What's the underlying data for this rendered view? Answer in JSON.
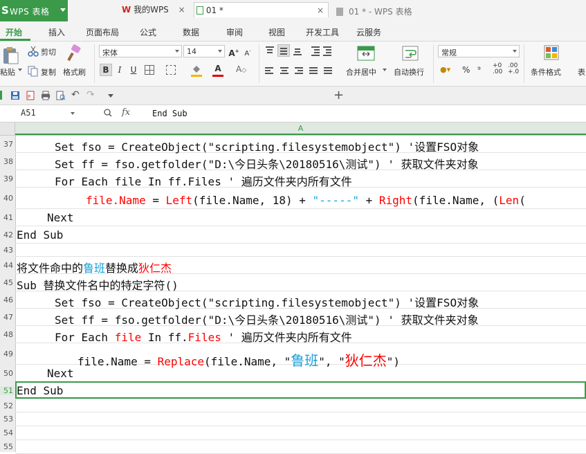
{
  "app": {
    "logo": "S",
    "name": "WPS 表格",
    "title": "01 * - WPS 表格"
  },
  "menu": {
    "tabs": [
      "开始",
      "插入",
      "页面布局",
      "公式",
      "数据",
      "审阅",
      "视图",
      "开发工具",
      "云服务"
    ]
  },
  "ribbon": {
    "cut": "剪切",
    "paste": "粘贴",
    "copy": "复制",
    "format_painter": "格式刷",
    "font_name": "宋体",
    "font_size": "14",
    "merge_center": "合并居中",
    "wrap_text": "自动换行",
    "number_format": "常规",
    "conditional_format": "条件格式",
    "table_style": "表"
  },
  "doc_tabs": {
    "mywps": "我的WPS",
    "current": "01 *"
  },
  "formula_bar": {
    "cell_ref": "A51",
    "fx": "fx",
    "content": "End Sub"
  },
  "grid": {
    "column": "A",
    "row_numbers": [
      "37",
      "38",
      "39",
      "40",
      "41",
      "42",
      "43",
      "44",
      "45",
      "46",
      "47",
      "48",
      "49",
      "50",
      "51",
      "52",
      "53",
      "54",
      "55"
    ],
    "rows": [
      {
        "row": "37",
        "indent": 55,
        "segments": [
          {
            "text": "Set fso = CreateObject(\"scripting.filesystemobject\") '设置FSO对象"
          }
        ]
      },
      {
        "row": "38",
        "indent": 55,
        "segments": [
          {
            "text": "Set ff = fso.getfolder(\"D:\\今日头条\\20180516\\测试\") ' 获取文件夹对象"
          }
        ]
      },
      {
        "row": "39",
        "indent": 55,
        "segments": [
          {
            "text": "For Each file In ff.Files  ' 遍历文件夹内所有文件"
          }
        ]
      },
      {
        "row": "40",
        "indent": 100,
        "segments": [
          {
            "text": "file.Name",
            "color": "red"
          },
          {
            "text": " = "
          },
          {
            "text": "Left",
            "color": "red"
          },
          {
            "text": "(file.Name, 18) + "
          },
          {
            "text": "\"-----\"",
            "color": "blue"
          },
          {
            "text": " + "
          },
          {
            "text": "Right",
            "color": "red"
          },
          {
            "text": "(file.Name, ("
          },
          {
            "text": "Len",
            "color": "red"
          },
          {
            "text": "("
          }
        ]
      },
      {
        "row": "41",
        "indent": 44,
        "segments": [
          {
            "text": "Next"
          }
        ]
      },
      {
        "row": "42",
        "indent": 0,
        "segments": [
          {
            "text": "End Sub"
          }
        ]
      },
      {
        "row": "43",
        "indent": 0,
        "segments": []
      },
      {
        "row": "44",
        "indent": 0,
        "segments": [
          {
            "text": "将文件命中的"
          },
          {
            "text": "鲁班",
            "color": "blue"
          },
          {
            "text": "替换成"
          },
          {
            "text": "狄仁杰",
            "color": "red"
          }
        ]
      },
      {
        "row": "45",
        "indent": 0,
        "segments": [
          {
            "text": "Sub 替换文件名中的特定字符()"
          }
        ]
      },
      {
        "row": "46",
        "indent": 55,
        "segments": [
          {
            "text": "Set fso = CreateObject(\"scripting.filesystemobject\") '设置FSO对象"
          }
        ]
      },
      {
        "row": "47",
        "indent": 55,
        "segments": [
          {
            "text": "Set ff = fso.getfolder(\"D:\\今日头条\\20180516\\测试\") ' 获取文件夹对象"
          }
        ]
      },
      {
        "row": "48",
        "indent": 55,
        "segments": [
          {
            "text": "For Each "
          },
          {
            "text": "file",
            "color": "red"
          },
          {
            "text": " In ff."
          },
          {
            "text": "Files",
            "color": "red"
          },
          {
            "text": "  ' 遍历文件夹内所有文件"
          }
        ]
      },
      {
        "row": "49",
        "indent": 88,
        "segments": [
          {
            "text": "file.Name = "
          },
          {
            "text": "Replace",
            "color": "red"
          },
          {
            "text": "(file.Name, \""
          },
          {
            "text": "鲁班",
            "color": "blue",
            "size": 20
          },
          {
            "text": "\", \""
          },
          {
            "text": "狄仁杰",
            "color": "red",
            "size": 20
          },
          {
            "text": "\")"
          }
        ]
      },
      {
        "row": "50",
        "indent": 44,
        "segments": [
          {
            "text": "Next"
          }
        ]
      },
      {
        "row": "51",
        "indent": 0,
        "segments": [
          {
            "text": "End Sub"
          }
        ]
      },
      {
        "row": "52",
        "indent": 0,
        "segments": []
      },
      {
        "row": "53",
        "indent": 0,
        "segments": []
      },
      {
        "row": "54",
        "indent": 0,
        "segments": []
      },
      {
        "row": "55",
        "indent": 0,
        "segments": []
      }
    ],
    "selected_row": "51"
  }
}
